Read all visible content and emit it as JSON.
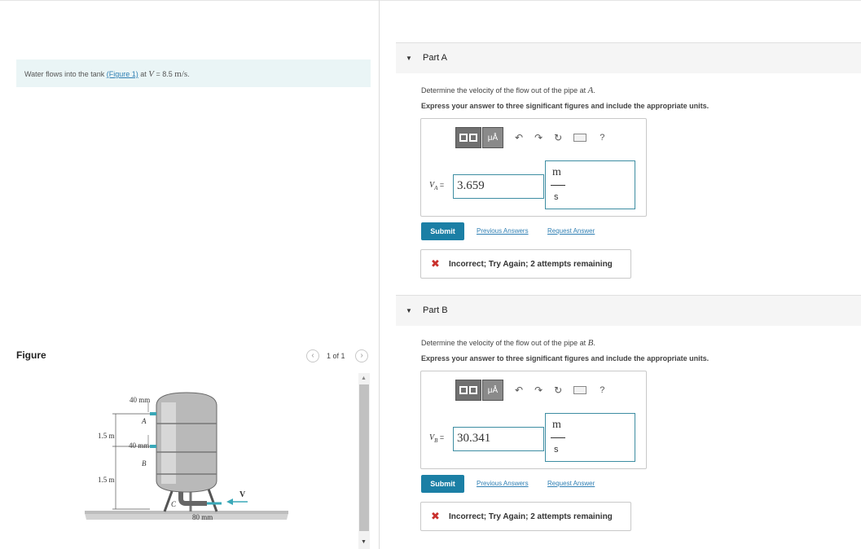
{
  "problem": {
    "text_before": "Water flows into the tank ",
    "figure_link": "(Figure 1)",
    "text_at": " at ",
    "var": "V",
    "equals": " = 8.5 ",
    "unit": "m/s",
    "period": "."
  },
  "figure_panel": {
    "title": "Figure",
    "pager": "1 of 1",
    "prev_icon": "chevron-left-icon",
    "next_icon": "chevron-right-icon",
    "labels": {
      "dim_a": "40 mm",
      "point_a": "A",
      "height_1": "1.5 m",
      "dim_b": "40 mm",
      "point_b": "B",
      "height_2": "1.5 m",
      "point_c": "C",
      "velocity": "V",
      "dim_c": "80 mm"
    }
  },
  "parts": [
    {
      "label": "Part A",
      "prompt_before": "Determine the velocity of the flow out of the pipe at ",
      "point": "A",
      "prompt_after": ".",
      "instruction": "Express your answer to three significant figures and include the appropriate units.",
      "toolbar": {
        "template_icon": "template-icon",
        "units_label": "μÅ",
        "undo_icon": "undo-icon",
        "redo_icon": "redo-icon",
        "reset_icon": "reset-icon",
        "keyboard_icon": "keyboard-icon",
        "help": "?"
      },
      "var": "V",
      "var_sub": "A",
      "eq": " =",
      "value": "3.659",
      "unit_num": "m",
      "unit_den": "s",
      "submit": "Submit",
      "previous": "Previous Answers",
      "request": "Request Answer",
      "feedback": "Incorrect; Try Again; 2 attempts remaining"
    },
    {
      "label": "Part B",
      "prompt_before": "Determine the velocity of the flow out of the pipe at ",
      "point": "B",
      "prompt_after": ".",
      "instruction": "Express your answer to three significant figures and include the appropriate units.",
      "toolbar": {
        "template_icon": "template-icon",
        "units_label": "μÅ",
        "undo_icon": "undo-icon",
        "redo_icon": "redo-icon",
        "reset_icon": "reset-icon",
        "keyboard_icon": "keyboard-icon",
        "help": "?"
      },
      "var": "V",
      "var_sub": "B",
      "eq": " =",
      "value": "30.341",
      "unit_num": "m",
      "unit_den": "s",
      "submit": "Submit",
      "previous": "Previous Answers",
      "request": "Request Answer",
      "feedback": "Incorrect; Try Again; 2 attempts remaining"
    }
  ],
  "colors": {
    "accent": "#1b7fa5",
    "link": "#2f7fb3",
    "error": "#c9302c",
    "problem_bg": "#eaf5f6",
    "input_border": "#3d8da2"
  }
}
